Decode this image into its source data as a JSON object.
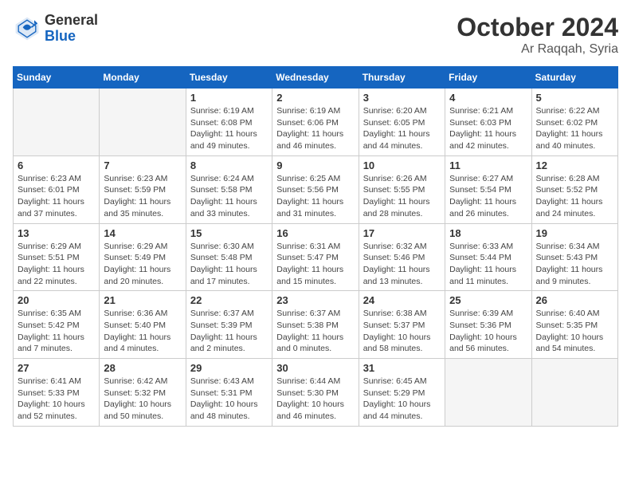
{
  "header": {
    "logo_general": "General",
    "logo_blue": "Blue",
    "month_title": "October 2024",
    "location": "Ar Raqqah, Syria"
  },
  "days_of_week": [
    "Sunday",
    "Monday",
    "Tuesday",
    "Wednesday",
    "Thursday",
    "Friday",
    "Saturday"
  ],
  "weeks": [
    [
      {
        "day": "",
        "info": ""
      },
      {
        "day": "",
        "info": ""
      },
      {
        "day": "1",
        "info": "Sunrise: 6:19 AM\nSunset: 6:08 PM\nDaylight: 11 hours and 49 minutes."
      },
      {
        "day": "2",
        "info": "Sunrise: 6:19 AM\nSunset: 6:06 PM\nDaylight: 11 hours and 46 minutes."
      },
      {
        "day": "3",
        "info": "Sunrise: 6:20 AM\nSunset: 6:05 PM\nDaylight: 11 hours and 44 minutes."
      },
      {
        "day": "4",
        "info": "Sunrise: 6:21 AM\nSunset: 6:03 PM\nDaylight: 11 hours and 42 minutes."
      },
      {
        "day": "5",
        "info": "Sunrise: 6:22 AM\nSunset: 6:02 PM\nDaylight: 11 hours and 40 minutes."
      }
    ],
    [
      {
        "day": "6",
        "info": "Sunrise: 6:23 AM\nSunset: 6:01 PM\nDaylight: 11 hours and 37 minutes."
      },
      {
        "day": "7",
        "info": "Sunrise: 6:23 AM\nSunset: 5:59 PM\nDaylight: 11 hours and 35 minutes."
      },
      {
        "day": "8",
        "info": "Sunrise: 6:24 AM\nSunset: 5:58 PM\nDaylight: 11 hours and 33 minutes."
      },
      {
        "day": "9",
        "info": "Sunrise: 6:25 AM\nSunset: 5:56 PM\nDaylight: 11 hours and 31 minutes."
      },
      {
        "day": "10",
        "info": "Sunrise: 6:26 AM\nSunset: 5:55 PM\nDaylight: 11 hours and 28 minutes."
      },
      {
        "day": "11",
        "info": "Sunrise: 6:27 AM\nSunset: 5:54 PM\nDaylight: 11 hours and 26 minutes."
      },
      {
        "day": "12",
        "info": "Sunrise: 6:28 AM\nSunset: 5:52 PM\nDaylight: 11 hours and 24 minutes."
      }
    ],
    [
      {
        "day": "13",
        "info": "Sunrise: 6:29 AM\nSunset: 5:51 PM\nDaylight: 11 hours and 22 minutes."
      },
      {
        "day": "14",
        "info": "Sunrise: 6:29 AM\nSunset: 5:49 PM\nDaylight: 11 hours and 20 minutes."
      },
      {
        "day": "15",
        "info": "Sunrise: 6:30 AM\nSunset: 5:48 PM\nDaylight: 11 hours and 17 minutes."
      },
      {
        "day": "16",
        "info": "Sunrise: 6:31 AM\nSunset: 5:47 PM\nDaylight: 11 hours and 15 minutes."
      },
      {
        "day": "17",
        "info": "Sunrise: 6:32 AM\nSunset: 5:46 PM\nDaylight: 11 hours and 13 minutes."
      },
      {
        "day": "18",
        "info": "Sunrise: 6:33 AM\nSunset: 5:44 PM\nDaylight: 11 hours and 11 minutes."
      },
      {
        "day": "19",
        "info": "Sunrise: 6:34 AM\nSunset: 5:43 PM\nDaylight: 11 hours and 9 minutes."
      }
    ],
    [
      {
        "day": "20",
        "info": "Sunrise: 6:35 AM\nSunset: 5:42 PM\nDaylight: 11 hours and 7 minutes."
      },
      {
        "day": "21",
        "info": "Sunrise: 6:36 AM\nSunset: 5:40 PM\nDaylight: 11 hours and 4 minutes."
      },
      {
        "day": "22",
        "info": "Sunrise: 6:37 AM\nSunset: 5:39 PM\nDaylight: 11 hours and 2 minutes."
      },
      {
        "day": "23",
        "info": "Sunrise: 6:37 AM\nSunset: 5:38 PM\nDaylight: 11 hours and 0 minutes."
      },
      {
        "day": "24",
        "info": "Sunrise: 6:38 AM\nSunset: 5:37 PM\nDaylight: 10 hours and 58 minutes."
      },
      {
        "day": "25",
        "info": "Sunrise: 6:39 AM\nSunset: 5:36 PM\nDaylight: 10 hours and 56 minutes."
      },
      {
        "day": "26",
        "info": "Sunrise: 6:40 AM\nSunset: 5:35 PM\nDaylight: 10 hours and 54 minutes."
      }
    ],
    [
      {
        "day": "27",
        "info": "Sunrise: 6:41 AM\nSunset: 5:33 PM\nDaylight: 10 hours and 52 minutes."
      },
      {
        "day": "28",
        "info": "Sunrise: 6:42 AM\nSunset: 5:32 PM\nDaylight: 10 hours and 50 minutes."
      },
      {
        "day": "29",
        "info": "Sunrise: 6:43 AM\nSunset: 5:31 PM\nDaylight: 10 hours and 48 minutes."
      },
      {
        "day": "30",
        "info": "Sunrise: 6:44 AM\nSunset: 5:30 PM\nDaylight: 10 hours and 46 minutes."
      },
      {
        "day": "31",
        "info": "Sunrise: 6:45 AM\nSunset: 5:29 PM\nDaylight: 10 hours and 44 minutes."
      },
      {
        "day": "",
        "info": ""
      },
      {
        "day": "",
        "info": ""
      }
    ]
  ]
}
